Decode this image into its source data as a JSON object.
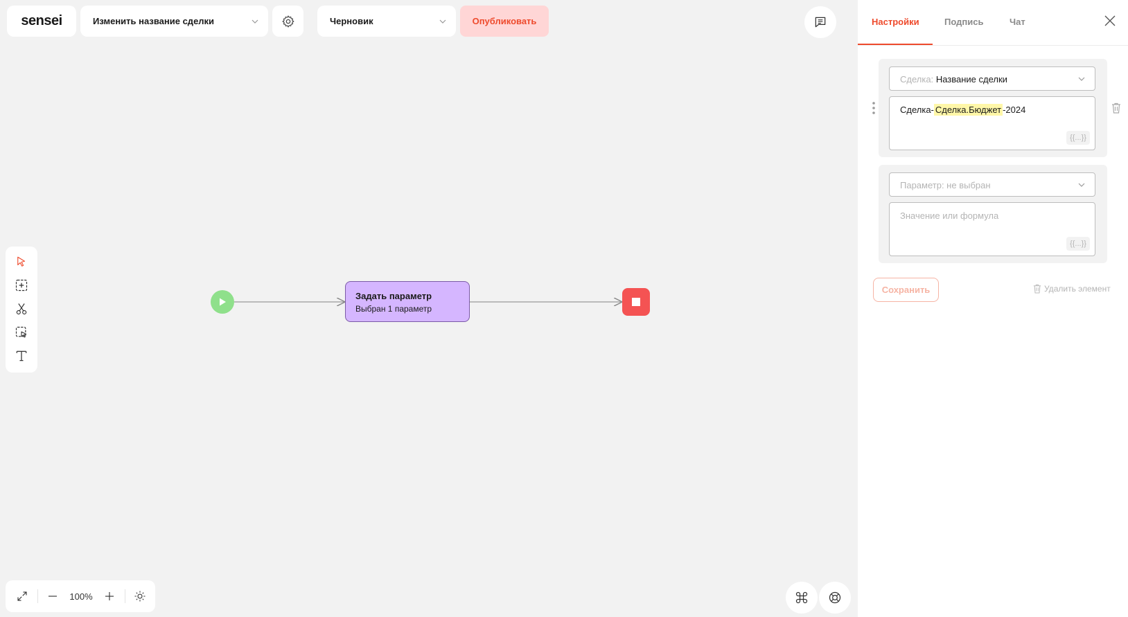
{
  "header": {
    "logo": "sensei",
    "process_name": "Изменить название сделки",
    "status": "Черновик",
    "publish_label": "Опубликовать"
  },
  "flow": {
    "task_title": "Задать параметр",
    "task_subtitle": "Выбран 1 параметр"
  },
  "zoom": {
    "level": "100%"
  },
  "panel": {
    "tabs": [
      {
        "label": "Настройки"
      },
      {
        "label": "Подпись"
      },
      {
        "label": "Чат"
      }
    ],
    "param1": {
      "select_prefix": "Сделка:",
      "select_value": "Название сделки",
      "formula_prefix": "Сделка-",
      "formula_variable": "Сделка.Бюджет",
      "formula_suffix": "-2024",
      "formula_button": "{{...}}"
    },
    "param2": {
      "select_placeholder": "Параметр: не выбран",
      "value_placeholder": "Значение или формула",
      "formula_button": "{{...}}"
    },
    "save_label": "Сохранить",
    "delete_label": "Удалить элемент"
  },
  "colors": {
    "accent": "#ee4a2c",
    "start_node": "#8fe08b",
    "task_node": "#d5b6ff",
    "end_node": "#f45353",
    "publish_bg": "#ffd6d6"
  }
}
